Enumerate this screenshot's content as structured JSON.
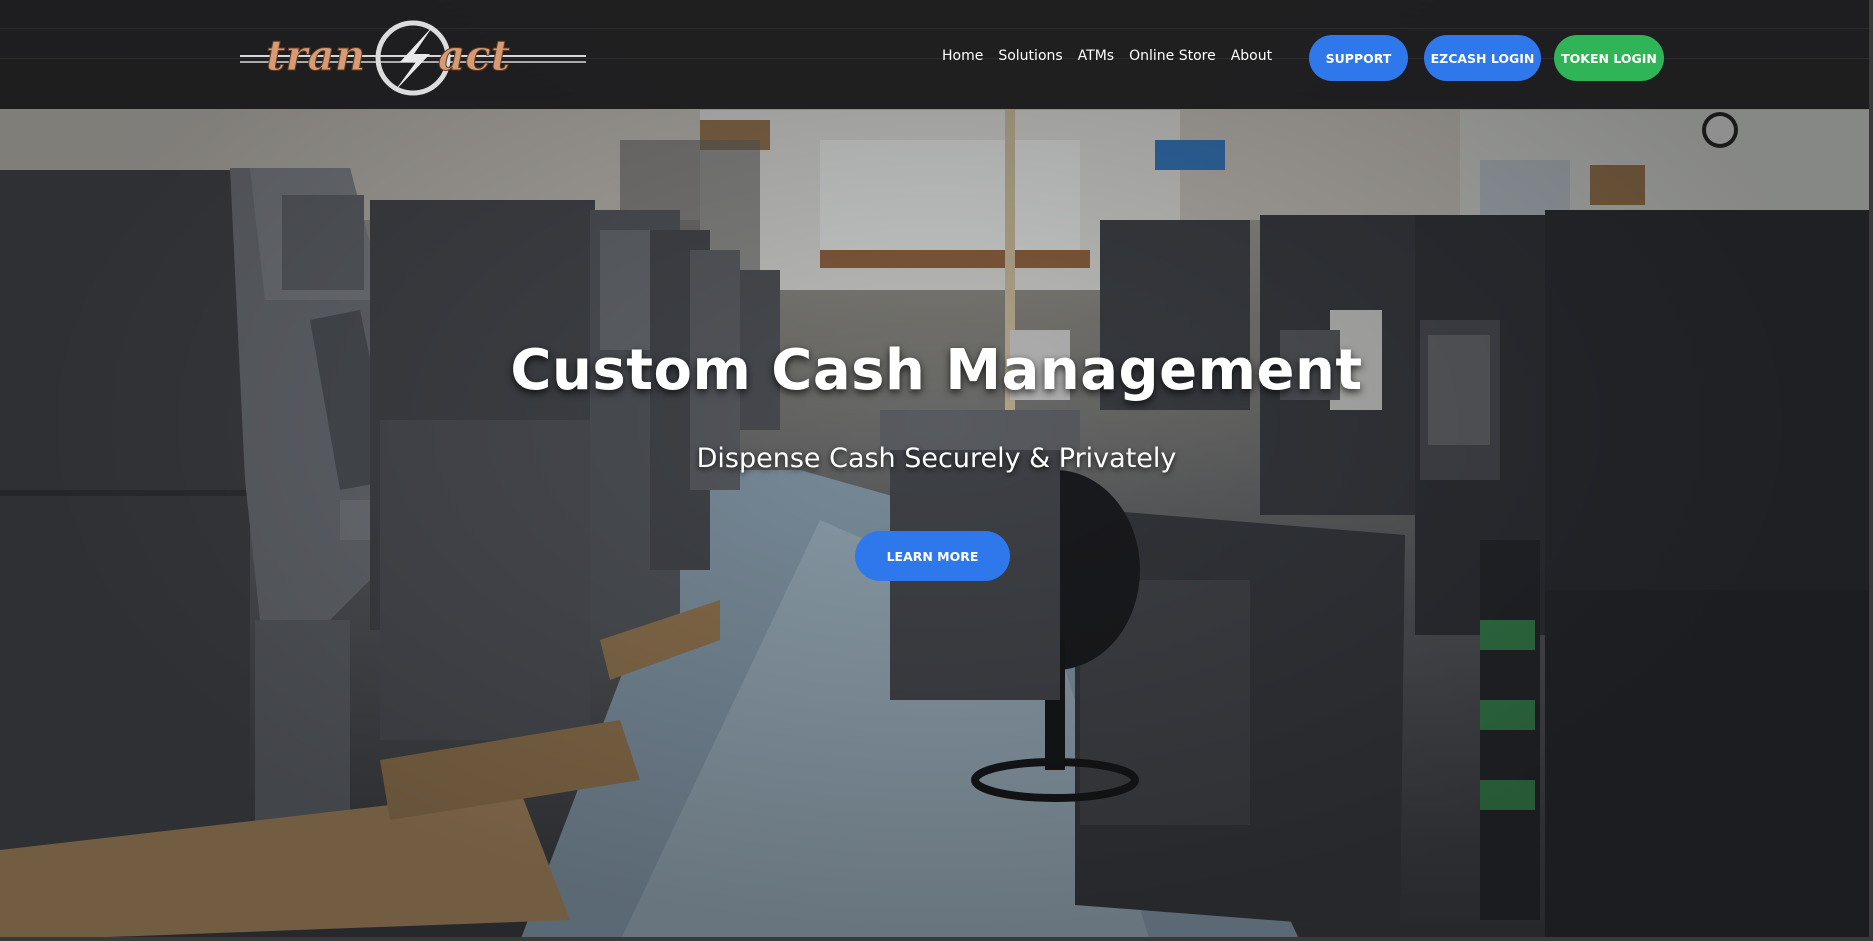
{
  "header": {
    "logo_text": "tranzact",
    "nav": [
      "Home",
      "Solutions",
      "ATMs",
      "Online Store",
      "About"
    ],
    "support_label": "SUPPORT",
    "ezcash_label": "EZCASH LOGIN",
    "token_label": "TOKEN LOGIN"
  },
  "hero": {
    "headline": "Custom Cash Management",
    "subheadline": "Dispense Cash Securely & Privately",
    "cta_label": "LEARN MORE"
  },
  "colors": {
    "header_bg": "#161618",
    "button_blue": "#2f78ec",
    "button_green": "#2fb457",
    "logo_copper": "#d79b74"
  }
}
